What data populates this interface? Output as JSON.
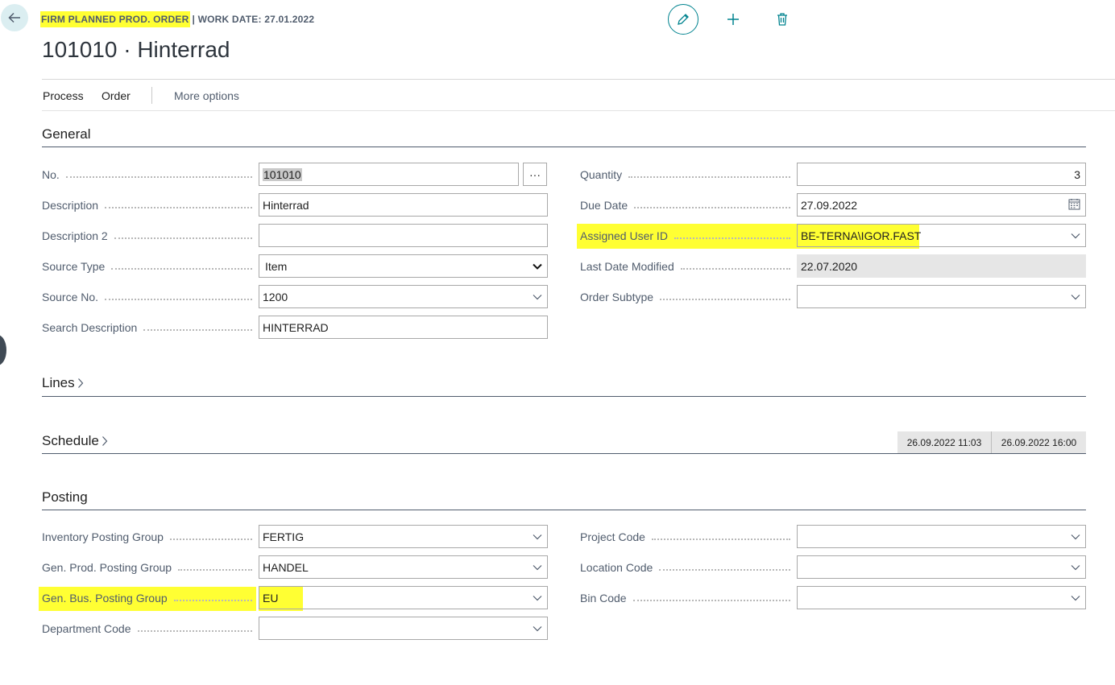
{
  "header": {
    "caption_highlighted": "FIRM PLANNED PROD. ORDER",
    "caption_rest": "| WORK DATE: 27.01.2022",
    "title": "101010 · Hinterrad"
  },
  "actions": {
    "process": "Process",
    "order": "Order",
    "more": "More options"
  },
  "sections": {
    "general": "General",
    "lines": "Lines",
    "schedule": "Schedule",
    "posting": "Posting"
  },
  "general": {
    "no": {
      "label": "No.",
      "value": "101010",
      "lookup": "···"
    },
    "description": {
      "label": "Description",
      "value": "Hinterrad"
    },
    "description2": {
      "label": "Description 2",
      "value": ""
    },
    "source_type": {
      "label": "Source Type",
      "value": "Item"
    },
    "source_no": {
      "label": "Source No.",
      "value": "1200"
    },
    "search_description": {
      "label": "Search Description",
      "value": "HINTERRAD"
    },
    "quantity": {
      "label": "Quantity",
      "value": "3"
    },
    "due_date": {
      "label": "Due Date",
      "value": "27.09.2022"
    },
    "assigned_user_id": {
      "label": "Assigned User ID",
      "value": "BE-TERNA\\IGOR.FAST"
    },
    "last_date_modified": {
      "label": "Last Date Modified",
      "value": "22.07.2020"
    },
    "order_subtype": {
      "label": "Order Subtype",
      "value": ""
    }
  },
  "schedule": {
    "start": "26.09.2022 11:03",
    "end": "26.09.2022 16:00"
  },
  "posting": {
    "inventory_posting_group": {
      "label": "Inventory Posting Group",
      "value": "FERTIG"
    },
    "gen_prod_posting_group": {
      "label": "Gen. Prod. Posting Group",
      "value": "HANDEL"
    },
    "gen_bus_posting_group": {
      "label": "Gen. Bus. Posting Group",
      "value": "EU"
    },
    "department_code": {
      "label": "Department Code",
      "value": ""
    },
    "project_code": {
      "label": "Project Code",
      "value": ""
    },
    "location_code": {
      "label": "Location Code",
      "value": ""
    },
    "bin_code": {
      "label": "Bin Code",
      "value": ""
    }
  },
  "colors": {
    "accent": "#00838f",
    "highlight": "#ffff33",
    "label": "#505c6d"
  },
  "icons": {
    "back": "back-arrow-icon",
    "edit": "pencil-icon",
    "new": "plus-icon",
    "delete": "trash-icon",
    "calendar": "calendar-icon",
    "dropdown": "chevron-down-icon"
  }
}
